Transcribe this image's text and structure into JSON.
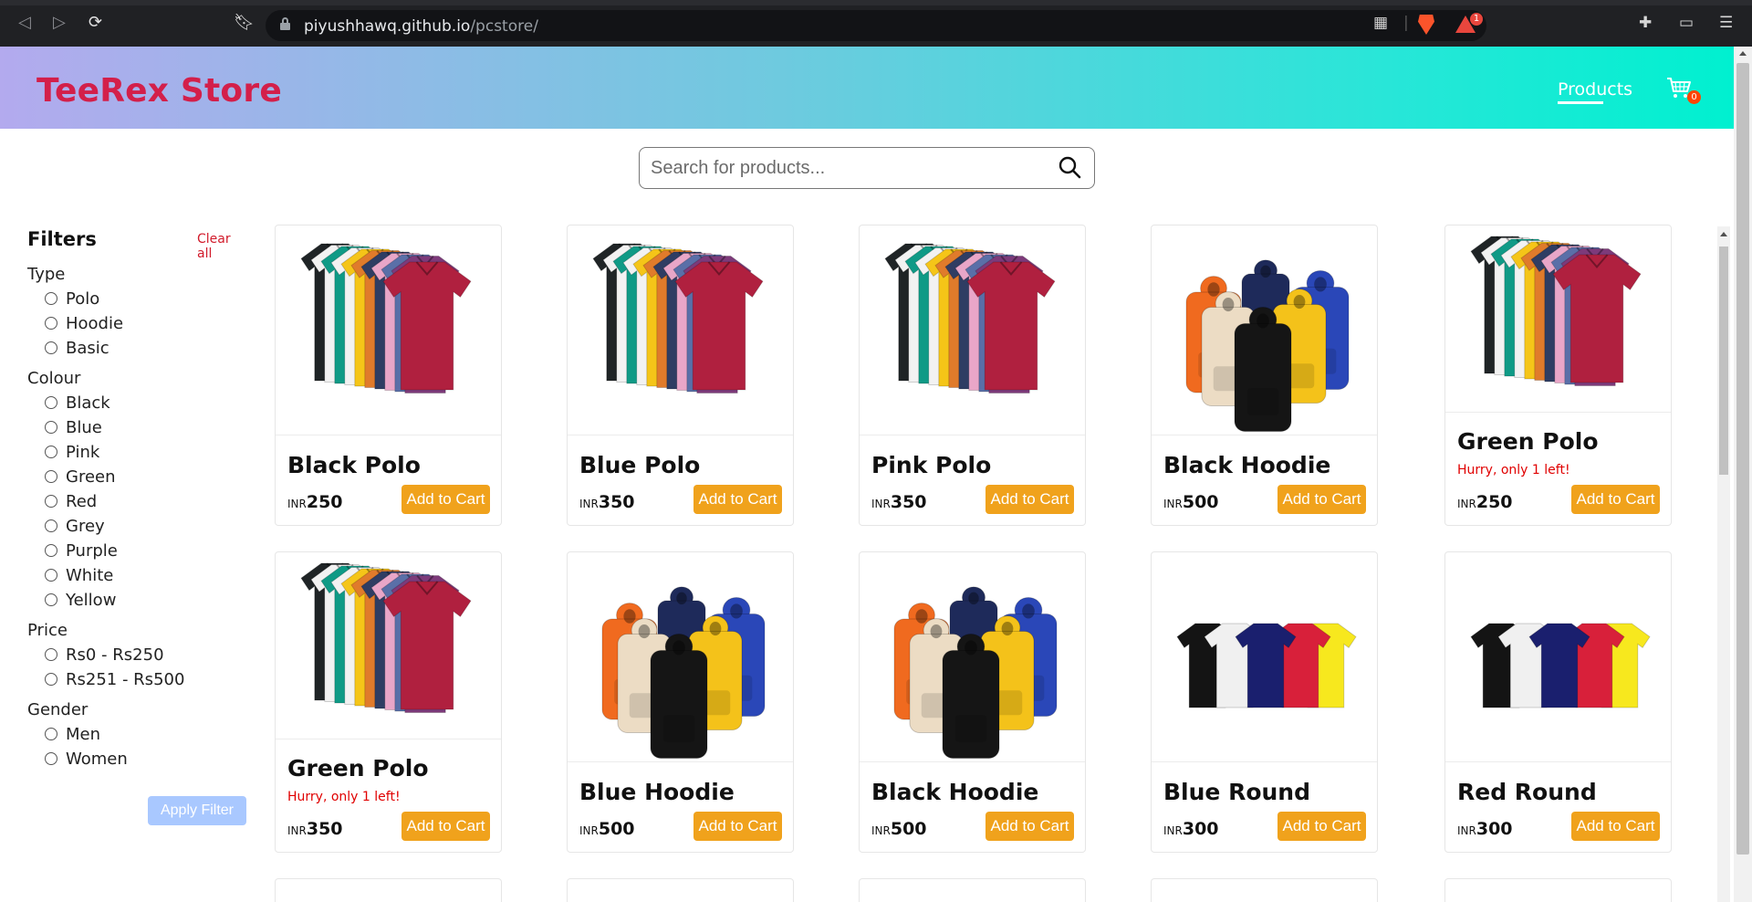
{
  "browser": {
    "url_host": "piyushhawq.github.io",
    "url_path": "/pcstore/",
    "rewards_badge": "1",
    "icons": [
      "back-icon",
      "forward-icon",
      "reload-icon",
      "bookmark-icon",
      "lock-icon",
      "qr-icon",
      "brave-shield-icon",
      "brave-rewards-icon",
      "extensions-icon",
      "wallet-icon",
      "menu-icon"
    ]
  },
  "header": {
    "logo": "TeeRex Store",
    "nav_products": "Products",
    "cart_count": "0",
    "cart_icon": "cart-icon"
  },
  "search": {
    "placeholder": "Search for products...",
    "value": "",
    "icon": "search-icon"
  },
  "filters": {
    "title": "Filters",
    "clear_label": "Clear all",
    "groups": [
      {
        "title": "Type",
        "options": [
          "Polo",
          "Hoodie",
          "Basic"
        ]
      },
      {
        "title": "Colour",
        "options": [
          "Black",
          "Blue",
          "Pink",
          "Green",
          "Red",
          "Grey",
          "Purple",
          "White",
          "Yellow"
        ]
      },
      {
        "title": "Price",
        "options": [
          "Rs0 - Rs250",
          "Rs251 - Rs500"
        ]
      },
      {
        "title": "Gender",
        "options": [
          "Men",
          "Women"
        ]
      }
    ],
    "apply_label": "Apply Filter"
  },
  "products": [
    {
      "name": "Black Polo",
      "currency": "INR",
      "price": "250",
      "image": "polo",
      "stock_note": "",
      "button": "Add to Cart"
    },
    {
      "name": "Blue Polo",
      "currency": "INR",
      "price": "350",
      "image": "polo",
      "stock_note": "",
      "button": "Add to Cart"
    },
    {
      "name": "Pink Polo",
      "currency": "INR",
      "price": "350",
      "image": "polo",
      "stock_note": "",
      "button": "Add to Cart"
    },
    {
      "name": "Black Hoodie",
      "currency": "INR",
      "price": "500",
      "image": "hoodie",
      "stock_note": "",
      "button": "Add to Cart"
    },
    {
      "name": "Green Polo",
      "currency": "INR",
      "price": "250",
      "image": "polo",
      "stock_note": "Hurry, only 1 left!",
      "button": "Add to Cart"
    },
    {
      "name": "Green Polo",
      "currency": "INR",
      "price": "350",
      "image": "polo",
      "stock_note": "Hurry, only 1 left!",
      "button": "Add to Cart"
    },
    {
      "name": "Blue Hoodie",
      "currency": "INR",
      "price": "500",
      "image": "hoodie",
      "stock_note": "",
      "button": "Add to Cart"
    },
    {
      "name": "Black Hoodie",
      "currency": "INR",
      "price": "500",
      "image": "hoodie",
      "stock_note": "",
      "button": "Add to Cart"
    },
    {
      "name": "Blue Round",
      "currency": "INR",
      "price": "300",
      "image": "round",
      "stock_note": "",
      "button": "Add to Cart"
    },
    {
      "name": "Red Round",
      "currency": "INR",
      "price": "300",
      "image": "round",
      "stock_note": "",
      "button": "Add to Cart"
    }
  ],
  "colors": {
    "logo": "#d31f4a",
    "add_button": "#f0a21c",
    "apply_button": "#a9c8ff",
    "stock_warning": "#e00000",
    "cart_badge": "#ff4500"
  }
}
